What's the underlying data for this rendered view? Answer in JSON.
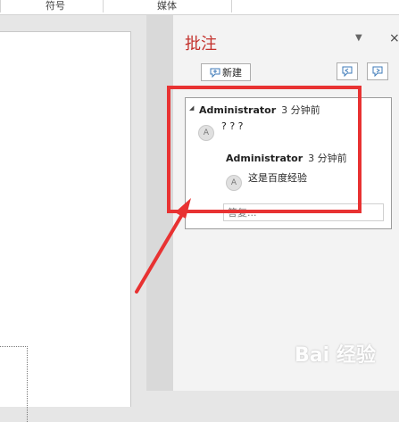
{
  "ribbon": {
    "groups": [
      "符号",
      "媒体"
    ]
  },
  "pane": {
    "title": "批注",
    "close": "×",
    "new_button": "新建"
  },
  "comment": {
    "author": "Administrator",
    "time": "3 分钟前",
    "avatar": "A",
    "text": "? ? ?",
    "reply": {
      "author": "Administrator",
      "time": "3 分钟前",
      "avatar": "A",
      "text": "这是百度经验"
    },
    "reply_placeholder": "答复..."
  },
  "watermark": "Bai 经验",
  "colors": {
    "accent": "#c3302b",
    "highlight": "#e83232"
  }
}
